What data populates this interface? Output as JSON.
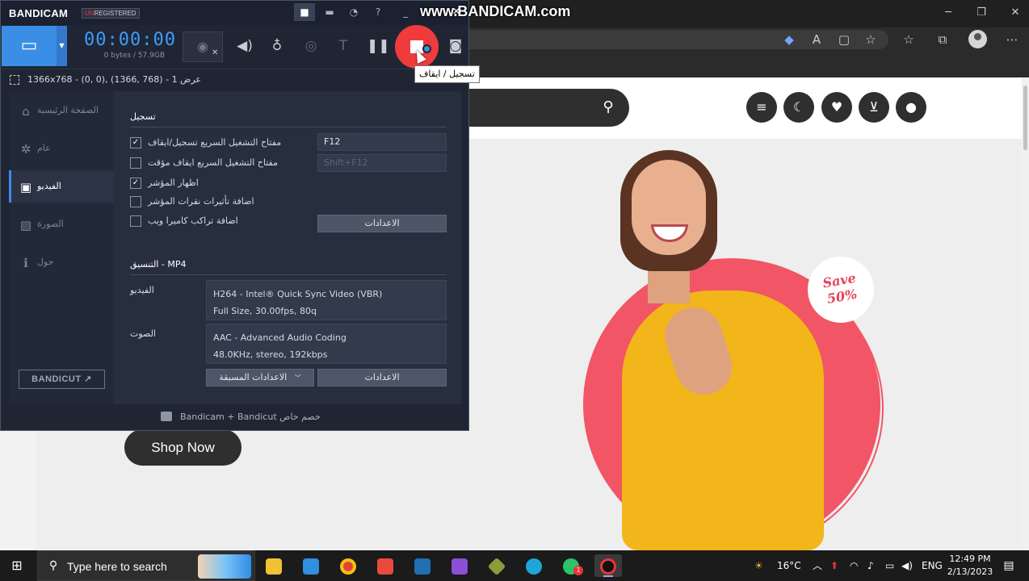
{
  "colors": {
    "accent": "#3a8ee6",
    "record": "#ef3b3b",
    "timer": "#3f9cff",
    "hero": "#f25565",
    "shirt": "#f2b51a"
  },
  "watermark": "www.BANDICAM.com",
  "bandicam": {
    "logo": "BANDICAM",
    "badge_prefix": "UN",
    "badge_rest": "REGISTERED",
    "title_icons": [
      "lock-icon",
      "folder-icon",
      "clock-icon",
      "help-icon",
      "minimize-icon",
      "close-icon"
    ],
    "timer": "00:00:00",
    "file_size": "0 bytes / 57.9GB",
    "tooltip": "تسجيل / ايقاف",
    "target": "1366x768 - (0, 0), (1366, 768) - عرض 1",
    "sidebar": [
      {
        "label": "الصفحة الرئيسية",
        "icon": "home-icon",
        "active": false
      },
      {
        "label": "عام",
        "icon": "gear-icon",
        "active": false
      },
      {
        "label": "الفيديو",
        "icon": "video-settings-icon",
        "active": true
      },
      {
        "label": "الصورة",
        "icon": "image-icon",
        "active": false
      },
      {
        "label": "حول",
        "icon": "info-icon",
        "active": false
      }
    ],
    "bandicut": "BANDICUT ↗",
    "record": {
      "title": "تسجيل",
      "options": [
        {
          "label": "مفتاح التشغيل السريع تسجيل/ايقاف",
          "checked": true
        },
        {
          "label": "مفتاح التشغيل السريع ايقاف مؤقت",
          "checked": false
        },
        {
          "label": "اظهار المؤشر",
          "checked": true
        },
        {
          "label": "اضافة تأثيرات نقرات المؤشر",
          "checked": false
        },
        {
          "label": "اضافة تراكب كاميرا ويب",
          "checked": false
        }
      ],
      "hotkey_record": "F12",
      "hotkey_pause": "Shift+F12",
      "settings_button": "الاعدادات"
    },
    "format": {
      "title": "التنسيق - MP4",
      "video_label": "الفيديو",
      "video_line1": "H264 - Intel® Quick Sync Video (VBR)",
      "video_line2": "Full Size, 30.00fps, 80q",
      "audio_label": "الصوت",
      "audio_line1": "AAC - Advanced Audio Coding",
      "audio_line2": "48.0KHz, stereo, 192kbps",
      "presets_button": "الاعدادات المسبقة",
      "settings_button": "الاعدادات"
    },
    "footer": "Bandicam + Bandicut خصم خاص"
  },
  "website": {
    "badge_line1": "Save",
    "badge_line2": "50%",
    "shop_button": "Shop Now"
  },
  "taskbar": {
    "search_placeholder": "Type here to search",
    "weather": "16°C",
    "language": "ENG",
    "time": "12:49 PM",
    "date": "2/13/2023",
    "mail_badge": "1"
  }
}
